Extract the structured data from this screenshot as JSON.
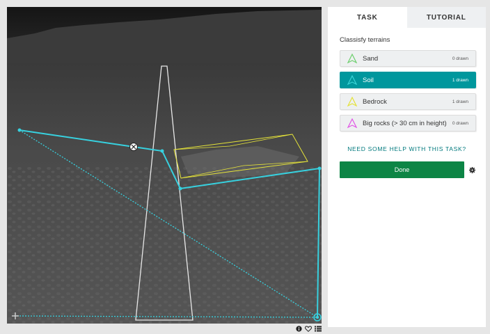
{
  "viewer": {
    "toolbar_icons": [
      "info-icon",
      "heart-icon",
      "collections-icon"
    ]
  },
  "tabs": [
    {
      "label": "TASK",
      "active": true
    },
    {
      "label": "TUTORIAL",
      "active": false
    }
  ],
  "task": {
    "question": "Classisfy terrains",
    "choices": [
      {
        "label": "Sand",
        "count": "0 drawn",
        "color": "#6fcf6f",
        "selected": false
      },
      {
        "label": "Soil",
        "count": "1 drawn",
        "color": "#39d3d6",
        "selected": true
      },
      {
        "label": "Bedrock",
        "count": "1 drawn",
        "color": "#e4e23a",
        "selected": false
      },
      {
        "label": "Big rocks (> 30 cm in height)",
        "count": "0 drawn",
        "color": "#e157e6",
        "selected": false
      }
    ],
    "help_link": "NEED SOME HELP WITH THIS TASK?",
    "done_label": "Done"
  },
  "colors": {
    "accent_teal": "#00979d",
    "done_green": "#0d8545",
    "soil_line": "#37d1df",
    "bedrock_line": "#e6e439"
  }
}
